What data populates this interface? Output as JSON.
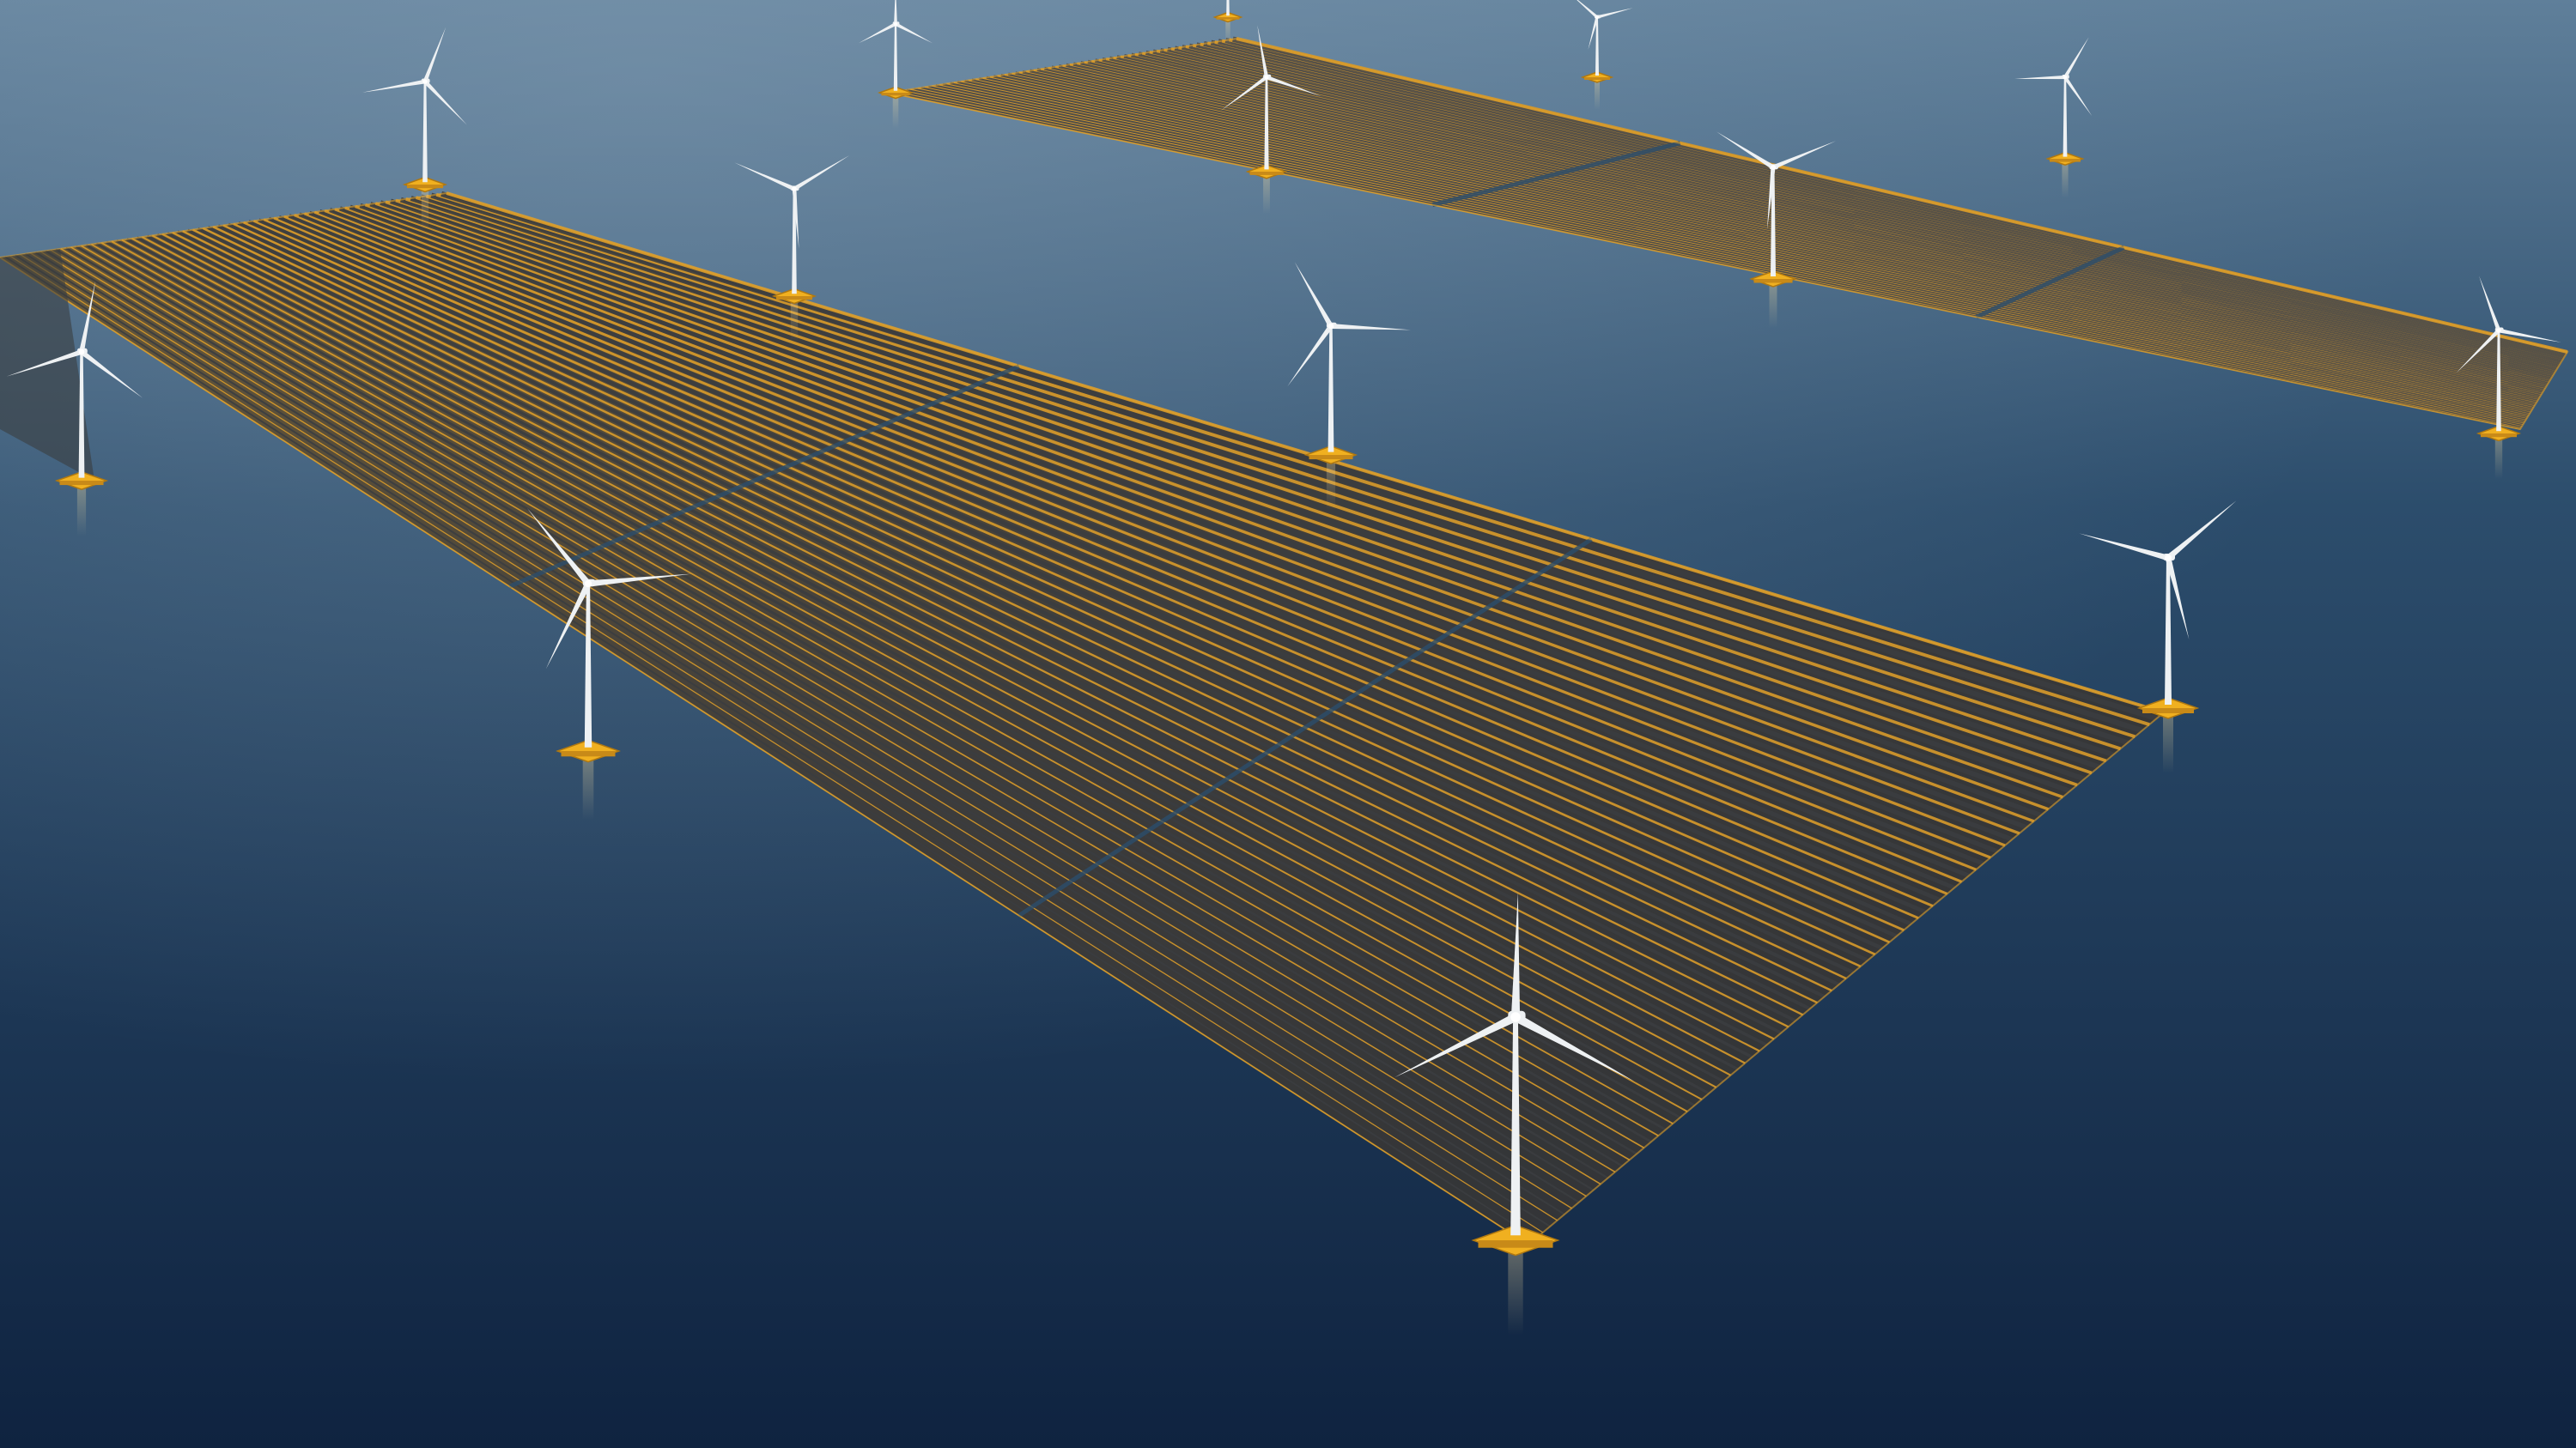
{
  "scene": {
    "description_visible_text": "",
    "colors": {
      "sea_top": "#5f7f9a",
      "sea_mid": "#2c4d6c",
      "sea_bottom": "#0f2340",
      "panel_dark": "#3b3d40",
      "panel_far": "#4a4a4a",
      "float_orange": "#e0a02a",
      "float_orange_light": "#f3c25a",
      "turbine_white": "#eef1f3",
      "platform_yellow": "#f0b020"
    },
    "objects": {
      "near_array": {
        "row_count": 44,
        "segments_along": 3
      },
      "far_array": {
        "row_count": 48,
        "segments_along": 3
      },
      "turbine_count": 16
    }
  }
}
